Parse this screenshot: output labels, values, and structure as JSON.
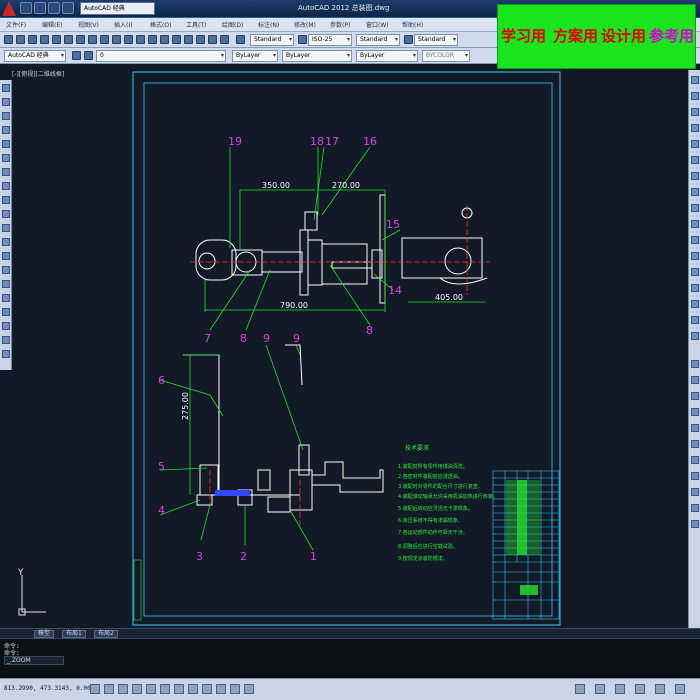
{
  "window": {
    "title": "AutoCAD 2012   总装图.dwg",
    "workspace": "AutoCAD 经典"
  },
  "menubar": {
    "items": [
      "文件(F)",
      "编辑(E)",
      "视图(V)",
      "插入(I)",
      "格式(O)",
      "工具(T)",
      "绘图(D)",
      "标注(N)",
      "修改(M)",
      "参数(P)",
      "窗口(W)",
      "帮助(H)"
    ]
  },
  "styles_toolbar": {
    "text_style": "Standard",
    "dim_style": "ISO-25",
    "table_style": "Standard",
    "mleader_style": "Standard"
  },
  "properties_toolbar": {
    "workspace": "AutoCAD 经典",
    "layer": "0",
    "color": "ByLayer",
    "linetype": "ByLayer",
    "lineweight": "ByLayer",
    "plotstyle": "BYCOLOR"
  },
  "promo": {
    "labels": [
      {
        "text": "学习用",
        "color": "#e30000"
      },
      {
        "text": "方案用",
        "color": "#e30000"
      },
      {
        "text": "设计用",
        "color": "#e30000"
      },
      {
        "text": "参考用",
        "color": "#d400d4"
      }
    ]
  },
  "viewport_tab": "[-][俯视][二维线框]",
  "drawing": {
    "dimensions": [
      "350.00",
      "270.00",
      "790.00",
      "405.00",
      "275.00"
    ],
    "balloons": [
      "19",
      "18",
      "17",
      "16",
      "15",
      "14",
      "8",
      "7",
      "8",
      "9",
      "9",
      "6",
      "5",
      "4",
      "3",
      "2",
      "1"
    ],
    "notes_title": "技术要求",
    "notes": [
      "1.装配前所有零件用煤油清洗。",
      "2.各密封件装配前应浸透油。",
      "3.装配时对零件的配合尺寸进行复查。",
      "4.装配滚动轴承允许采用机油加热进行热装。",
      "5.装配后转动应灵活无卡滞现象。",
      "6.液压系统不得有渗漏现象。",
      "7.各运动部件动作可靠无干涉。",
      "8.调整后应进行空载试验。",
      "9.按规定涂装防锈漆。"
    ],
    "axis_label": "Y"
  },
  "layout_tabs": [
    "模型",
    "布局1",
    "布局2"
  ],
  "command": {
    "line1": "命令:",
    "line2": "命令:",
    "input_value": "_.ZOOM"
  },
  "status": {
    "coords": "813.2990, 473.3143, 0.0000"
  },
  "colors": {
    "drawing_bg": "#111a26",
    "frame": "#33c9ff",
    "geometry": "#ffffff",
    "leaders": "#25e02a",
    "balloons": "#e23fe3",
    "centerline": "#ff2a2a"
  }
}
